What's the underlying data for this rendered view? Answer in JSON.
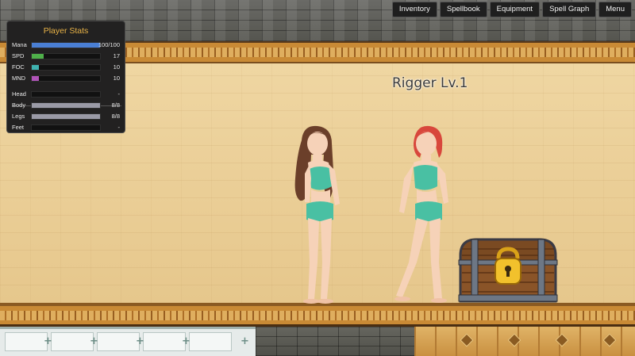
{
  "menu": {
    "inventory": "Inventory",
    "spellbook": "Spellbook",
    "equipment": "Equipment",
    "spell_graph": "Spell Graph",
    "menu": "Menu"
  },
  "stats": {
    "title": "Player Stats",
    "rows": [
      {
        "label": "Mana",
        "value": "100/100",
        "fill": 1.0,
        "color": "#4a7fd4"
      },
      {
        "label": "SPD",
        "value": "17",
        "fill": 0.17,
        "color": "#4fb04a"
      },
      {
        "label": "FOC",
        "value": "10",
        "fill": 0.1,
        "color": "#3fb3b0"
      },
      {
        "label": "MND",
        "value": "10",
        "fill": 0.1,
        "color": "#b054b8"
      },
      {
        "label": "Head",
        "value": "-",
        "fill": 0.0,
        "color": "#9a9aa6"
      },
      {
        "label": "Body",
        "value": "8/8",
        "fill": 1.0,
        "color": "#9a9aa6"
      },
      {
        "label": "Legs",
        "value": "8/8",
        "fill": 1.0,
        "color": "#9a9aa6"
      },
      {
        "label": "Feet",
        "value": "-",
        "fill": 0.0,
        "color": "#9a9aa6"
      }
    ]
  },
  "enemy": {
    "name": "Rigger Lv.1"
  },
  "colors": {
    "player_hair": "#6b3f2a",
    "enemy_hair": "#d8473c",
    "outfit": "#49c0a3",
    "skin": "#f6d2b8"
  }
}
